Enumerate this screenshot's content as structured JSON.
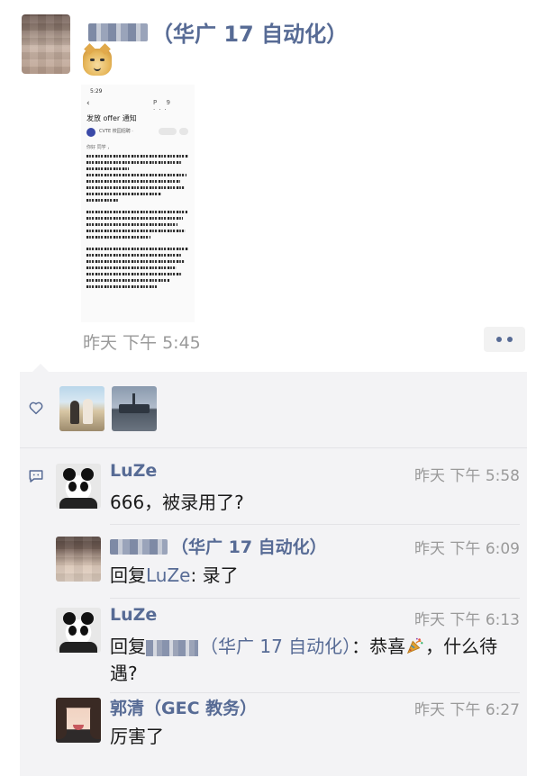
{
  "post": {
    "author_suffix": "（华广 17 自动化）",
    "time": "昨天 下午 5:45",
    "emoji_icon": "dog-face-emoji",
    "screenshot": {
      "status_time": "5:29",
      "back": "‹",
      "top_icons": "P 9 ···",
      "subject": "发放 offer 通知",
      "sender": "CVTE 校园招聘 ·",
      "greeting": "你好 同学 ，"
    }
  },
  "likes": {
    "icon": "heart-outline-icon",
    "avatars": [
      "couple-photo-avatar",
      "ship-photo-avatar"
    ]
  },
  "comments": {
    "icon": "comment-bubble-icon",
    "items": [
      {
        "name": "LuZe",
        "time": "昨天 下午 5:58",
        "text": "666，被录用了?"
      },
      {
        "name_suffix": "（华广 17 自动化）",
        "time": "昨天 下午 6:09",
        "reply_prefix": "回复",
        "reply_to": "LuZe",
        "text": ": 录了"
      },
      {
        "name": "LuZe",
        "time": "昨天 下午 6:13",
        "reply_prefix": "回复",
        "reply_to_suffix": "（华广 17 自动化）",
        "text_a": "：恭喜",
        "text_b": "，什么待遇?"
      },
      {
        "name": "郭清（GEC 教务）",
        "time": "昨天 下午 6:27",
        "text": "厉害了"
      }
    ]
  },
  "colors": {
    "link": "#576b95",
    "panel": "#f3f3f5",
    "time": "#9a9a9a"
  }
}
